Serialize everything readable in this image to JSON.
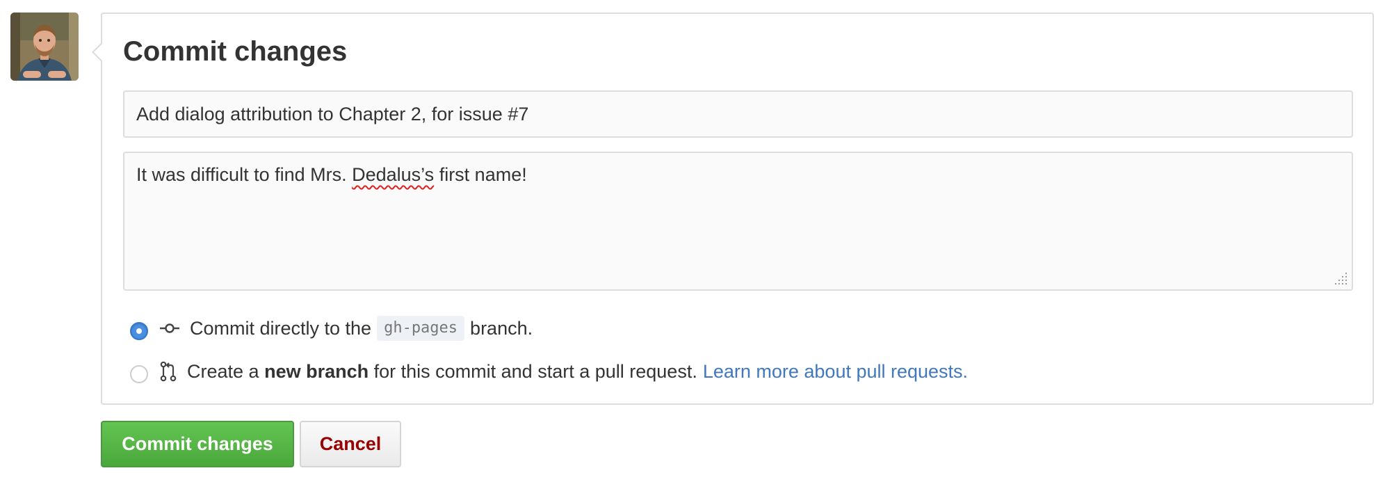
{
  "avatar": {
    "alt": "user avatar"
  },
  "commit_form": {
    "title": "Commit changes",
    "summary_value": "Add dialog attribution to Chapter 2, for issue #7",
    "description_parts": {
      "before": "It was difficult to find Mrs. ",
      "misspelled": "Dedalus’s",
      "after": " first name!"
    },
    "option_direct": {
      "text_before": "Commit directly to the",
      "branch": "gh-pages",
      "text_after": "branch.",
      "selected": true,
      "icon": "git-commit-icon"
    },
    "option_new_branch": {
      "text_before": "Create a",
      "bold": "new branch",
      "text_after": "for this commit and start a pull request.",
      "link": "Learn more about pull requests.",
      "selected": false,
      "icon": "git-pull-request-icon"
    }
  },
  "buttons": {
    "commit_label": "Commit changes",
    "cancel_label": "Cancel"
  },
  "colors": {
    "commit_button": "#55b848",
    "cancel_text": "#990000",
    "link": "#4078c0",
    "radio_selected": "#4a8fe0"
  }
}
